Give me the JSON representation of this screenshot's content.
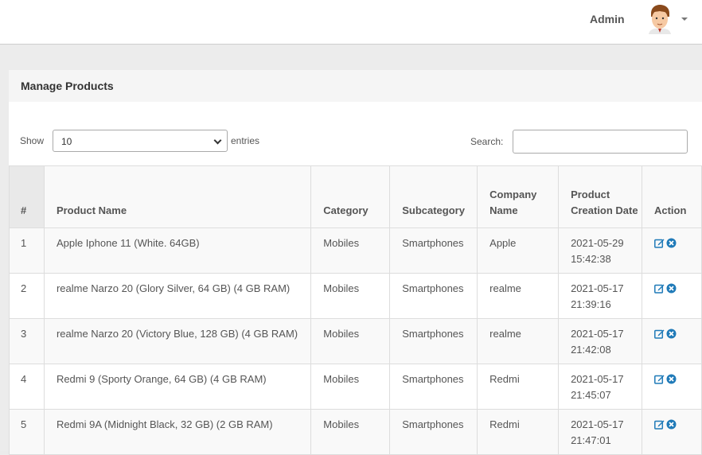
{
  "header": {
    "user_name": "Admin",
    "avatar_icon": "avatar-icon",
    "dropdown_icon": "caret-down-icon"
  },
  "panel": {
    "title": "Manage Products"
  },
  "controls": {
    "show_label": "Show",
    "entries_value": "10",
    "entries_label": "entries",
    "search_label": "Search:",
    "search_value": ""
  },
  "table": {
    "columns": [
      "#",
      "Product Name",
      "Category",
      "Subcategory",
      "Company Name",
      "Product Creation Date",
      "Action"
    ],
    "rows": [
      {
        "num": "1",
        "name": "Apple Iphone 11 (White. 64GB)",
        "category": "Mobiles",
        "subcategory": "Smartphones",
        "company": "Apple",
        "date": "2021-05-29",
        "time": "15:42:38"
      },
      {
        "num": "2",
        "name": "realme Narzo 20 (Glory Silver, 64 GB) (4 GB RAM)",
        "category": "Mobiles",
        "subcategory": "Smartphones",
        "company": "realme",
        "date": "2021-05-17",
        "time": "21:39:16"
      },
      {
        "num": "3",
        "name": "realme Narzo 20 (Victory Blue, 128 GB) (4 GB RAM)",
        "category": "Mobiles",
        "subcategory": "Smartphones",
        "company": "realme",
        "date": "2021-05-17",
        "time": "21:42:08"
      },
      {
        "num": "4",
        "name": "Redmi 9 (Sporty Orange, 64 GB) (4 GB RAM)",
        "category": "Mobiles",
        "subcategory": "Smartphones",
        "company": "Redmi",
        "date": "2021-05-17",
        "time": "21:45:07"
      },
      {
        "num": "5",
        "name": "Redmi 9A (Midnight Black, 32 GB) (2 GB RAM)",
        "category": "Mobiles",
        "subcategory": "Smartphones",
        "company": "Redmi",
        "date": "2021-05-17",
        "time": "21:47:01"
      }
    ],
    "action_icons": [
      "edit-icon",
      "delete-icon"
    ]
  },
  "colors": {
    "action_blue": "#1f7ab8"
  }
}
